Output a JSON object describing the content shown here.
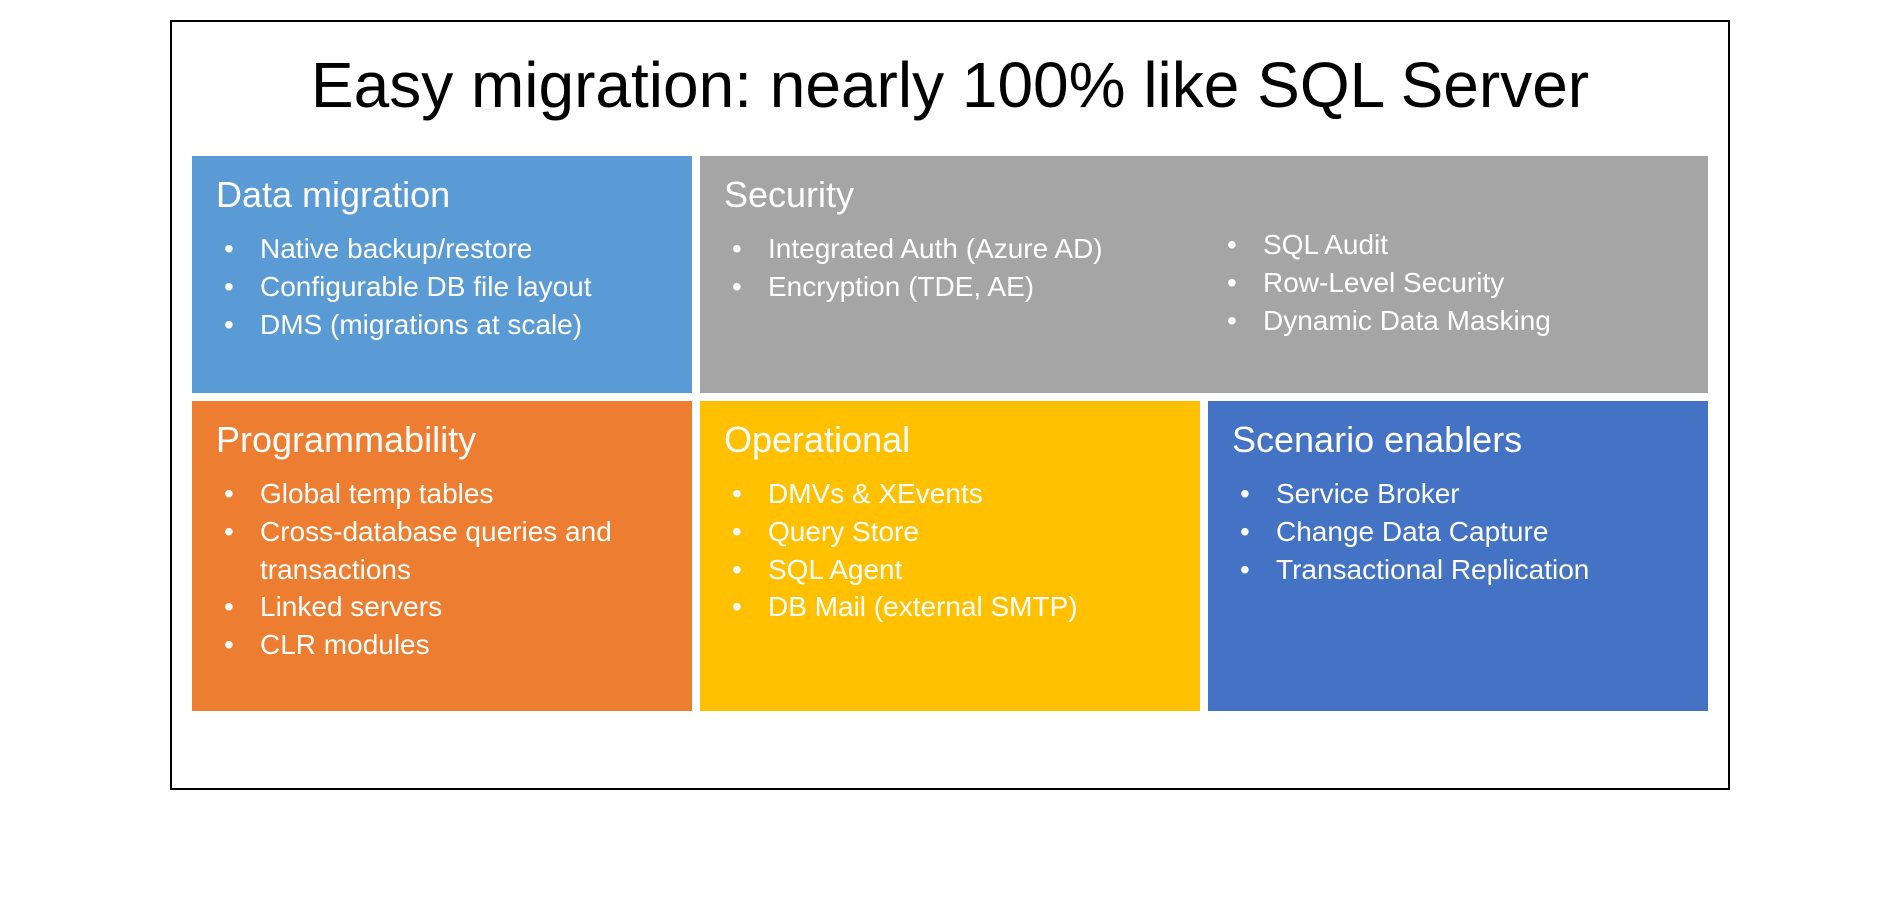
{
  "title": "Easy migration: nearly 100% like SQL Server",
  "cards": {
    "data_migration": {
      "heading": "Data migration",
      "bullets": [
        "Native backup/restore",
        "Configurable DB file layout",
        "DMS (migrations at scale)"
      ]
    },
    "security": {
      "heading": "Security",
      "col1": [
        "Integrated Auth (Azure AD)",
        "Encryption (TDE, AE)"
      ],
      "col2": [
        "SQL Audit",
        "Row-Level Security",
        "Dynamic Data Masking"
      ]
    },
    "programmability": {
      "heading": "Programmability",
      "bullets": [
        "Global temp tables",
        "Cross-database queries and transactions",
        "Linked servers",
        "CLR modules"
      ]
    },
    "operational": {
      "heading": "Operational",
      "bullets": [
        "DMVs & XEvents",
        "Query Store",
        "SQL Agent",
        "DB Mail (external SMTP)"
      ]
    },
    "scenario": {
      "heading": "Scenario enablers",
      "bullets": [
        "Service Broker",
        "Change Data Capture",
        "Transactional Replication"
      ]
    }
  }
}
